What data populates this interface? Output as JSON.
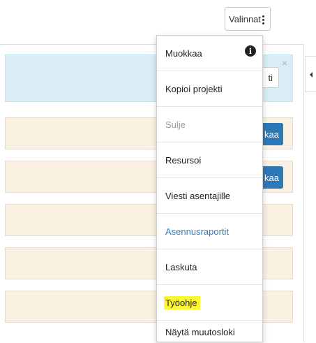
{
  "header": {
    "options_button_label": "Valinnat"
  },
  "alert": {
    "button_label_fragment": "ti",
    "close_glyph": "×"
  },
  "rows": [
    {
      "button_label_fragment": "kaa"
    },
    {
      "button_label_fragment": "kaa"
    },
    {},
    {},
    {}
  ],
  "menu": {
    "items": [
      {
        "label": "Muokkaa",
        "state": "normal",
        "icon": "info-icon"
      },
      {
        "label": "Kopioi projekti",
        "state": "normal"
      },
      {
        "label": "Sulje",
        "state": "disabled"
      },
      {
        "label": "Resursoi",
        "state": "normal"
      },
      {
        "label": "Viesti asentajille",
        "state": "normal"
      },
      {
        "label": "Asennusraportit",
        "state": "link"
      },
      {
        "label": "Laskuta",
        "state": "normal"
      },
      {
        "label": "Työohje",
        "state": "highlighted"
      },
      {
        "label": "Näytä muutosloki",
        "state": "normal"
      }
    ]
  },
  "colors": {
    "alert_bg": "#d9edf7",
    "row_bg": "#faf0e2",
    "primary_button": "#2f78b8",
    "link": "#337ab7",
    "highlight": "#fcf733"
  }
}
